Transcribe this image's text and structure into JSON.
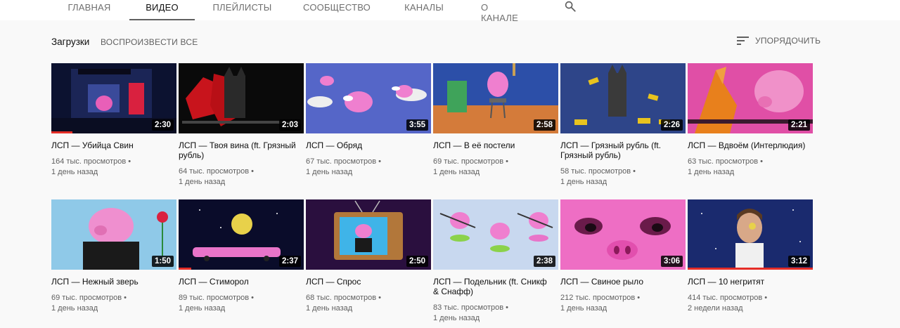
{
  "tabs": [
    "ГЛАВНАЯ",
    "ВИДЕО",
    "ПЛЕЙЛИСТЫ",
    "СООБЩЕСТВО",
    "КАНАЛЫ",
    "О КАНАЛЕ"
  ],
  "active_tab": "ВИДЕО",
  "section": {
    "title": "Загрузки",
    "play_all": "ВОСПРОИЗВЕСТИ ВСЕ",
    "sort": "УПОРЯДОЧИТЬ"
  },
  "videos": [
    {
      "title": "ЛСП — Убийца Свин",
      "views": "164 тыс. просмотров",
      "age": "1 день назад",
      "duration": "2:30",
      "watched": 0.17
    },
    {
      "title": "ЛСП — Твоя вина (ft. Грязный рубль)",
      "views": "64 тыс. просмотров",
      "age": "1 день назад",
      "duration": "2:03",
      "watched": 0
    },
    {
      "title": "ЛСП — Обряд",
      "views": "67 тыс. просмотров",
      "age": "1 день назад",
      "duration": "3:55",
      "watched": 0
    },
    {
      "title": "ЛСП — В её постели",
      "views": "69 тыс. просмотров",
      "age": "1 день назад",
      "duration": "2:58",
      "watched": 0
    },
    {
      "title": "ЛСП — Грязный рубль (ft. Грязный рубль)",
      "views": "58 тыс. просмотров",
      "age": "1 день назад",
      "duration": "2:26",
      "watched": 0
    },
    {
      "title": "ЛСП — Вдвоём (Интерлюдия)",
      "views": "63 тыс. просмотров",
      "age": "1 день назад",
      "duration": "2:21",
      "watched": 0
    },
    {
      "title": "ЛСП — Нежный зверь",
      "views": "69 тыс. просмотров",
      "age": "1 день назад",
      "duration": "1:50",
      "watched": 0
    },
    {
      "title": "ЛСП — Стиморол",
      "views": "89 тыс. просмотров",
      "age": "1 день назад",
      "duration": "2:37",
      "watched": 0.1
    },
    {
      "title": "ЛСП — Спрос",
      "views": "68 тыс. просмотров",
      "age": "1 день назад",
      "duration": "2:50",
      "watched": 0
    },
    {
      "title": "ЛСП — Подельник (ft. Сникф & Снафф)",
      "views": "83 тыс. просмотров",
      "age": "1 день назад",
      "duration": "2:38",
      "watched": 0
    },
    {
      "title": "ЛСП — Свиное рыло",
      "views": "212 тыс. просмотров",
      "age": "1 день назад",
      "duration": "3:06",
      "watched": 0
    },
    {
      "title": "ЛСП — 10 негритят",
      "views": "414 тыс. просмотров",
      "age": "2 недели назад",
      "duration": "3:12",
      "watched": 1.0
    }
  ],
  "colors": {
    "accent_red": "#e52d27",
    "text_secondary": "#606060",
    "background": "#f9f9f9"
  },
  "icons": {
    "search": "search-icon",
    "sort": "sort-icon"
  }
}
